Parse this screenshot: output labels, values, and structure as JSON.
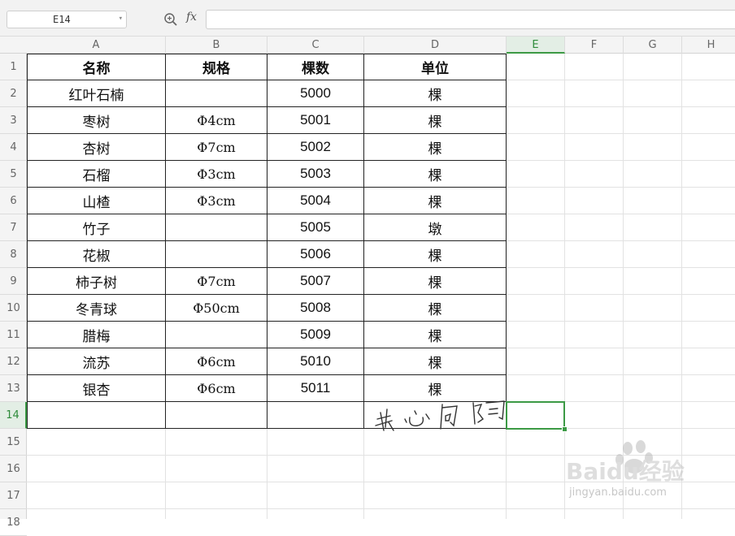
{
  "formula_bar": {
    "cell_reference": "E14",
    "fx_label": "fx",
    "formula_value": ""
  },
  "columns": [
    "A",
    "B",
    "C",
    "D",
    "E",
    "F",
    "G",
    "H"
  ],
  "rows": [
    "1",
    "2",
    "3",
    "4",
    "5",
    "6",
    "7",
    "8",
    "9",
    "10",
    "11",
    "12",
    "13",
    "14",
    "15",
    "16",
    "17",
    "18"
  ],
  "active_cell": {
    "column": "E",
    "row": "14"
  },
  "table": {
    "headers": [
      "名称",
      "规格",
      "棵数",
      "单位"
    ],
    "rows": [
      [
        "红叶石楠",
        "",
        "5000",
        "棵"
      ],
      [
        "枣树",
        "Φ4cm",
        "5001",
        "棵"
      ],
      [
        "杏树",
        "Φ7cm",
        "5002",
        "棵"
      ],
      [
        "石榴",
        "Φ3cm",
        "5003",
        "棵"
      ],
      [
        "山楂",
        "Φ3cm",
        "5004",
        "棵"
      ],
      [
        "竹子",
        "",
        "5005",
        "墩"
      ],
      [
        "花椒",
        "",
        "5006",
        "棵"
      ],
      [
        "柿子树",
        "Φ7cm",
        "5007",
        "棵"
      ],
      [
        "冬青球",
        "Φ50cm",
        "5008",
        "棵"
      ],
      [
        "腊梅",
        "",
        "5009",
        "棵"
      ],
      [
        "流苏",
        "Φ6cm",
        "5010",
        "棵"
      ],
      [
        "银杏",
        "Φ6cm",
        "5011",
        "棵"
      ],
      [
        "",
        "",
        "",
        ""
      ]
    ]
  },
  "handwritten_note": "我心向阳",
  "watermark": {
    "brand": "Baidu经验",
    "url": "jingyan.baidu.com"
  },
  "colors": {
    "accent_green": "#3c9a45",
    "table_border": "#222222",
    "grid_line": "#e2e2e2"
  }
}
